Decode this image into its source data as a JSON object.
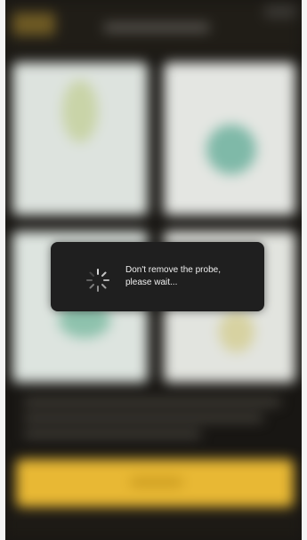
{
  "screen": {
    "background_color": "#181613",
    "accent_color": "#e8b834"
  },
  "loading_dialog": {
    "line1": "Don't remove the probe,",
    "line2": "please wait...",
    "icon": "spinner-icon"
  }
}
